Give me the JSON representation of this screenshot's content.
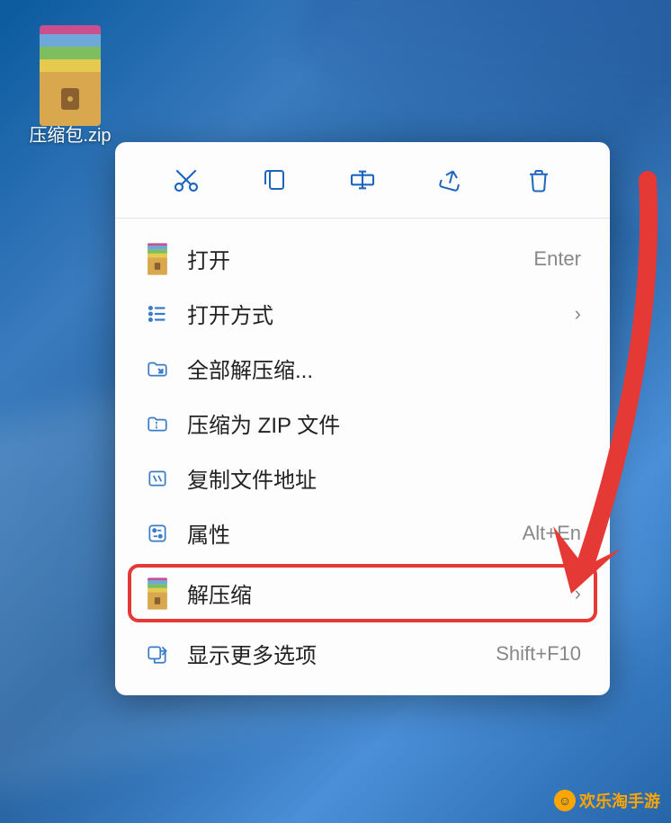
{
  "file": {
    "name": "压缩包.zip"
  },
  "toolbar": {
    "cut": "cut",
    "copy": "copy",
    "rename": "rename",
    "share": "share",
    "delete": "delete"
  },
  "menu": {
    "open": {
      "label": "打开",
      "shortcut": "Enter"
    },
    "open_with": {
      "label": "打开方式"
    },
    "extract_all": {
      "label": "全部解压缩..."
    },
    "compress_zip": {
      "label": "压缩为 ZIP 文件"
    },
    "copy_path": {
      "label": "复制文件地址"
    },
    "properties": {
      "label": "属性",
      "shortcut": "Alt+En"
    },
    "extract": {
      "label": "解压缩"
    },
    "show_more": {
      "label": "显示更多选项",
      "shortcut": "Shift+F10"
    }
  },
  "watermark": {
    "text": "欢乐淘手游"
  },
  "chevron": "›"
}
